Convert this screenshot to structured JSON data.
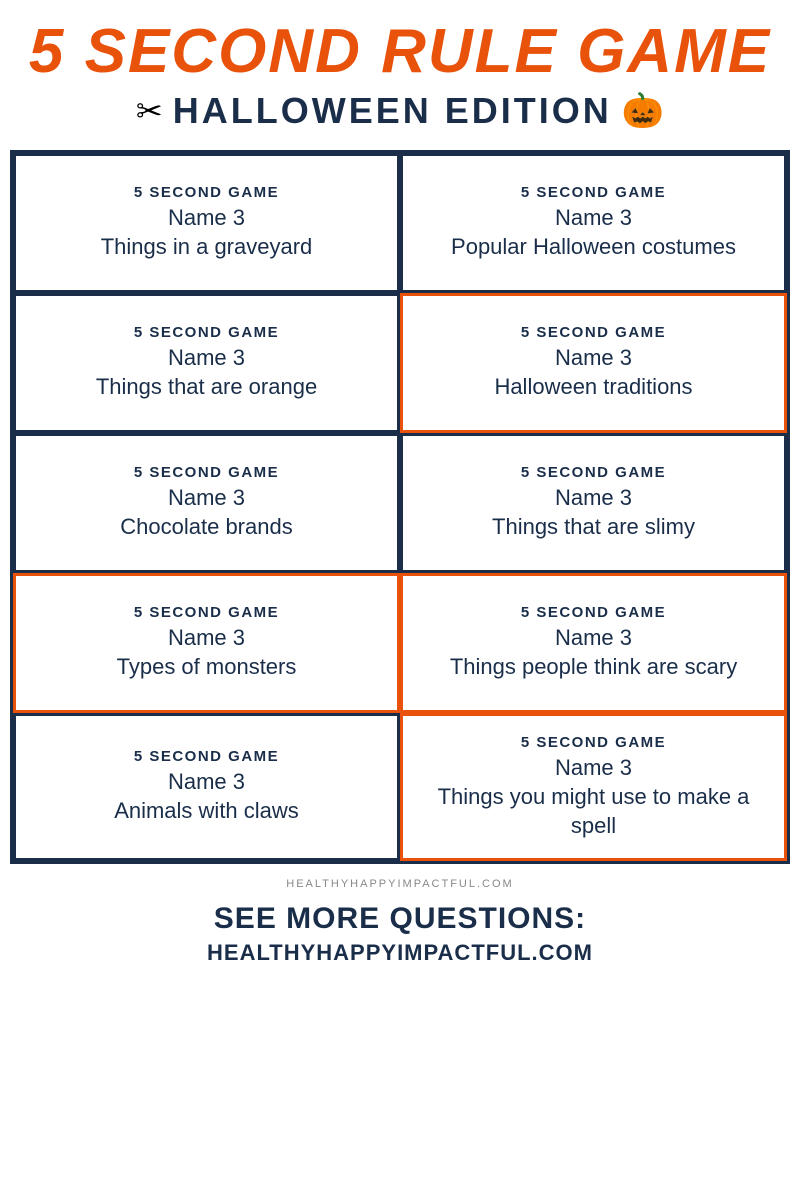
{
  "header": {
    "title_main": "5 Second Rule Game",
    "title_sub": "Halloween Edition",
    "scissors": "✂",
    "pumpkin": "🎃"
  },
  "cards": [
    {
      "label": "5 SECOND GAME",
      "name_text": "Name 3",
      "prompt": "Things in a graveyard",
      "orange": false
    },
    {
      "label": "5 SECOND GAME",
      "name_text": "Name 3",
      "prompt": "Popular Halloween costumes",
      "orange": false
    },
    {
      "label": "5 SECOND GAME",
      "name_text": "Name 3",
      "prompt": "Things that are orange",
      "orange": false
    },
    {
      "label": "5 SECOND GAME",
      "name_text": "Name 3",
      "prompt": "Halloween traditions",
      "orange": true
    },
    {
      "label": "5 SECOND GAME",
      "name_text": "Name 3",
      "prompt": "Chocolate brands",
      "orange": false
    },
    {
      "label": "5 SECOND GAME",
      "name_text": "Name 3",
      "prompt": "Things that are slimy",
      "orange": false
    },
    {
      "label": "5 SECOND GAME",
      "name_text": "Name 3",
      "prompt": "Types of monsters",
      "orange": true
    },
    {
      "label": "5 SECOND GAME",
      "name_text": "Name 3",
      "prompt": "Things people think are scary",
      "orange": true
    },
    {
      "label": "5 SECOND GAME",
      "name_text": "Name 3",
      "prompt": "Animals with claws",
      "orange": false
    },
    {
      "label": "5 SECOND GAME",
      "name_text": "Name 3",
      "prompt": "Things you might use to make a spell",
      "orange": true
    }
  ],
  "footer": {
    "url_small": "HEALTHYHAPPYIMPACTFUL.COM",
    "see_more": "SEE MORE QUESTIONS:",
    "url_large": "HEALTHYHAPPYIMPACTFUL.COM"
  }
}
